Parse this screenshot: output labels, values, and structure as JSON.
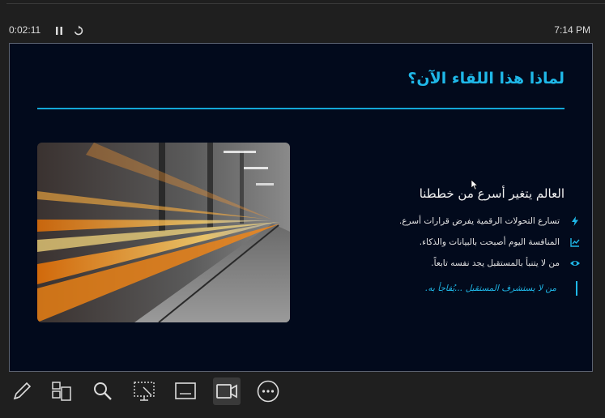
{
  "presenter": {
    "elapsed_time": "0:02:11",
    "clock": "7:14 PM"
  },
  "slide": {
    "title": "لماذا هذا اللقاء الآن؟",
    "subheading": "العالم يتغير أسرع من خططنا",
    "bullets": [
      {
        "icon": "bolt-icon",
        "text": "تسارع التحولات الرقمية يفرض قرارات أسرع."
      },
      {
        "icon": "chart-icon",
        "text": "المنافسة اليوم أصبحت بالبيانات والذكاء."
      },
      {
        "icon": "eye-icon",
        "text": "من لا يتنبأ بالمستقبل يجد نفسه تابعاً."
      }
    ],
    "quote": "من لا يستشرف المستقبل ...يُفاجأ به.",
    "colors": {
      "accent": "#1fb8e8",
      "background": "#020a1c"
    }
  },
  "toolbar": {
    "tools": [
      "pen-tool",
      "slides-grid",
      "zoom",
      "pointer-screen",
      "subtitles",
      "camera",
      "more-options"
    ],
    "active_tool": "camera"
  }
}
